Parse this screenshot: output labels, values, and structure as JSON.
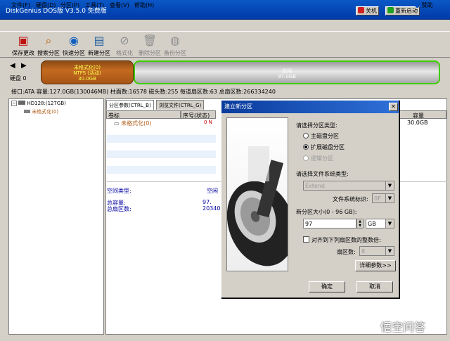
{
  "window": {
    "title": "DiskGenius DOS版 V3.5.0 免费版",
    "btn_shutdown": "关机",
    "btn_reboot": "重新启动"
  },
  "menu": [
    "文件(F)",
    "硬盘(D)",
    "分区(P)",
    "工具(T)",
    "查看(V)",
    "帮助(H)"
  ],
  "help_label": "赞助",
  "toolbar": [
    {
      "label": "保存更改",
      "icon": "save-icon",
      "disabled": false
    },
    {
      "label": "搜索分区",
      "icon": "search-icon",
      "disabled": false
    },
    {
      "label": "快速分区",
      "icon": "quick-partition-icon",
      "disabled": false
    },
    {
      "label": "新建分区",
      "icon": "new-partition-icon",
      "disabled": false
    },
    {
      "label": "格式化",
      "icon": "format-icon",
      "disabled": true
    },
    {
      "label": "删除分区",
      "icon": "delete-icon",
      "disabled": true
    },
    {
      "label": "备份分区",
      "icon": "backup-icon",
      "disabled": true
    }
  ],
  "disk": {
    "label": "硬盘 0",
    "part1": {
      "name": "未格式化(0)",
      "fs": "NTFS (活动)",
      "size": "30.0GB",
      "color": "#b05c18"
    },
    "part2": {
      "name": "空闲",
      "size": "97.0GB",
      "border": "#3ecf00"
    }
  },
  "diskinfo": "接口:ATA  容量:127.0GB(130046MB)  柱面数:16578  磁头数:255  每道扇区数:63  总扇区数:266334240",
  "tree": {
    "disk": "HD128:(127GB)",
    "part": "未格式化(0)"
  },
  "tabs": [
    "分区参数(CTRL_B)",
    "浏览文件(CTRL_G)"
  ],
  "columns": [
    "卷标",
    "序号(状态)",
    "容量"
  ],
  "row": {
    "name": "未格式化(0)",
    "seq": "0 N",
    "capacity": "30.0GB"
  },
  "details": {
    "space_type_label": "空间类型:",
    "space_type_value": "空闲",
    "total_cap_label": "总容量:",
    "total_cap_value": "97.",
    "total_sec_label": "总扇区数:",
    "total_sec_value": "20340"
  },
  "dialog": {
    "title": "建立新分区",
    "part_type_label": "请选择分区类型:",
    "radio_primary": "主磁盘分区",
    "radio_extended": "扩展磁盘分区",
    "radio_logical": "逻辑分区",
    "fs_type_label": "请选择文件系统类型:",
    "fs_value": "Extend",
    "fs_id_label": "文件系统标识:",
    "fs_id_value": "0F",
    "size_label": "新分区大小(0 - 96 GB):",
    "size_value": "97",
    "size_unit": "GB",
    "align_label": "对齐到下列扇区数的整数倍:",
    "sector_label": "扇区数:",
    "sector_value": "8",
    "detail_btn": "详细参数>>",
    "ok_btn": "确定",
    "cancel_btn": "取消"
  },
  "watermark": "悟空问答"
}
